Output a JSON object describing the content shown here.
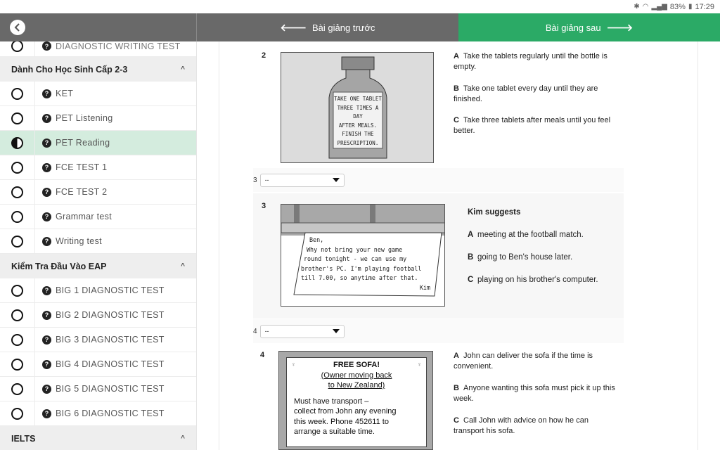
{
  "status": {
    "bluetooth_icon": "bluetooth-icon",
    "wifi_icon": "wifi-icon",
    "signal_icon": "signal-icon",
    "battery": "83%",
    "time": "17:29"
  },
  "nav": {
    "prev_label": "Bài giảng trước",
    "next_label": "Bài giảng sau"
  },
  "sidebar": {
    "partial_item": "DIAGNOSTIC WRITING TEST",
    "section1": "Dành Cho Học Sinh Cấp 2-3",
    "items1": [
      "KET",
      "PET Listening",
      "PET Reading",
      "FCE TEST 1",
      "FCE TEST 2",
      "Grammar test",
      "Writing test"
    ],
    "section2": "Kiểm Tra Đầu Vào EAP",
    "items2": [
      "BIG 1 DIAGNOSTIC TEST",
      "BIG 2 DIAGNOSTIC TEST",
      "BIG 3 DIAGNOSTIC TEST",
      "BIG 4 DIAGNOSTIC TEST",
      "BIG 5 DIAGNOSTIC TEST",
      "BIG 6 DIAGNOSTIC TEST"
    ],
    "section3": "IELTS"
  },
  "q2": {
    "num": "2",
    "label_lines": [
      "TAKE ONE TABLET",
      "THREE TIMES A DAY",
      "AFTER MEALS.",
      "FINISH THE",
      "PRESCRIPTION."
    ],
    "A": "Take the tablets regularly until the bottle is empty.",
    "B": "Take one tablet every day until they are finished.",
    "C": "Take three tablets after meals until you feel better."
  },
  "sel3": {
    "num": "3",
    "value": "--"
  },
  "q3": {
    "num": "3",
    "note_lines": [
      "Ben,",
      "Why not bring your new game",
      "round tonight - we can use my",
      "brother's PC. I'm playing football",
      "till 7.00, so anytime after that.",
      "Kim"
    ],
    "title": "Kim suggests",
    "A": "meeting at the football match.",
    "B": "going to Ben's house later.",
    "C": "playing on his brother's computer."
  },
  "sel4": {
    "num": "4",
    "value": "--"
  },
  "q4": {
    "num": "4",
    "ad_title": "FREE SOFA!",
    "ad_sub1": "(Owner moving back",
    "ad_sub2": "to New Zealand)",
    "ad_body": [
      "Must have transport –",
      "collect from John any evening",
      "this week. Phone 452611 to",
      "arrange a suitable time."
    ],
    "A": "John can deliver the sofa if the time is convenient.",
    "B": "Anyone wanting this sofa must pick it up this week.",
    "C": "Call John with advice on how he can transport his sofa."
  },
  "letters": {
    "A": "A",
    "B": "B",
    "C": "C"
  }
}
